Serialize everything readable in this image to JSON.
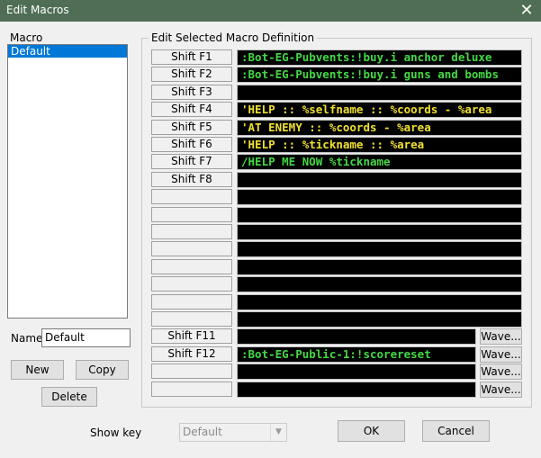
{
  "window": {
    "title": "Edit Macros",
    "close_glyph": "✕"
  },
  "macro_list": {
    "label": "Macro",
    "items": [
      "Default"
    ]
  },
  "name_field": {
    "label": "Name:",
    "value": "Default"
  },
  "buttons": {
    "new": "New",
    "copy": "Copy",
    "delete": "Delete",
    "ok": "OK",
    "cancel": "Cancel"
  },
  "definition": {
    "label": "Edit Selected Macro Definition",
    "rows": [
      {
        "key": "Shift F1",
        "text": ":Bot-EG-Pubvents:!buy.i anchor deluxe",
        "color": "#44d944"
      },
      {
        "key": "Shift F2",
        "text": ":Bot-EG-Pubvents:!buy.i guns and bombs",
        "color": "#44d944"
      },
      {
        "key": "Shift F3",
        "text": "",
        "color": "#44d944"
      },
      {
        "key": "Shift F4",
        "text": "'HELP :: %selfname :: %coords - %area",
        "color": "#f0e030"
      },
      {
        "key": "Shift F5",
        "text": "'AT ENEMY :: %coords - %area",
        "color": "#f0e030"
      },
      {
        "key": "Shift F6",
        "text": "'HELP :: %tickname :: %area",
        "color": "#f0e030"
      },
      {
        "key": "Shift F7",
        "text": "/HELP ME NOW %tickname",
        "color": "#44d944"
      },
      {
        "key": "Shift F8",
        "text": "",
        "color": "#44d944"
      },
      {
        "key": "",
        "text": "",
        "color": "#44d944"
      },
      {
        "key": "",
        "text": "",
        "color": "#44d944"
      },
      {
        "key": "",
        "text": "",
        "color": "#44d944"
      },
      {
        "key": "",
        "text": "",
        "color": "#44d944"
      },
      {
        "key": "",
        "text": "",
        "color": "#44d944"
      },
      {
        "key": "",
        "text": "",
        "color": "#44d944"
      },
      {
        "key": "",
        "text": "",
        "color": "#44d944"
      },
      {
        "key": "",
        "text": "",
        "color": "#44d944"
      },
      {
        "key": "Shift F11",
        "text": "",
        "color": "#44d944",
        "wave": "Wave..."
      },
      {
        "key": "Shift F12",
        "text": ":Bot-EG-Public-1:!scorereset",
        "color": "#44d944",
        "wave": "Wave..."
      },
      {
        "key": "",
        "text": "",
        "color": "#44d944",
        "wave": "Wave..."
      },
      {
        "key": "",
        "text": "",
        "color": "#44d944",
        "wave": "Wave..."
      }
    ]
  },
  "show_key": {
    "label": "Show key",
    "value": "Default"
  },
  "icons": {
    "close": "close-icon",
    "dropdown": "chevron-down-icon"
  },
  "colors": {
    "titlebar": "#4f6e55",
    "selection": "#0078d7",
    "field_bg": "#000000"
  }
}
